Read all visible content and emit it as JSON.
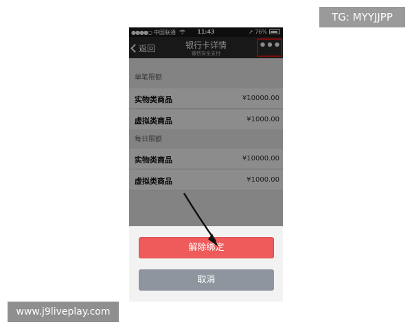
{
  "watermark": {
    "tg": "TG: MYYJJPP",
    "url": "www.j9liveplay.com"
  },
  "status_bar": {
    "signal": "●●●●○",
    "carrier": "中国联通",
    "time": "11:43",
    "battery": "76%"
  },
  "nav": {
    "back_label": "返回",
    "title": "银行卡详情",
    "subtitle": "微信安全支付",
    "more_label": "•••"
  },
  "sections": [
    {
      "header": "单笔限额",
      "rows": [
        {
          "label": "实物类商品",
          "value": "¥10000.00"
        },
        {
          "label": "虚拟类商品",
          "value": "¥1000.00"
        }
      ]
    },
    {
      "header": "每日限额",
      "rows": [
        {
          "label": "实物类商品",
          "value": "¥10000.00"
        },
        {
          "label": "虚拟类商品",
          "value": "¥1000.00"
        }
      ]
    }
  ],
  "action_sheet": {
    "unbind_label": "解除绑定",
    "cancel_label": "取消"
  },
  "colors": {
    "highlight_box": "#e01b1b",
    "unbind": "#ef5b5b",
    "cancel": "#8f959e",
    "nav_bar": "#2c2c2c"
  },
  "icons": {
    "back": "chevron-left-icon",
    "more": "more-dots-icon",
    "wifi": "wifi-icon",
    "battery": "battery-icon",
    "location": "location-arrow-icon"
  }
}
